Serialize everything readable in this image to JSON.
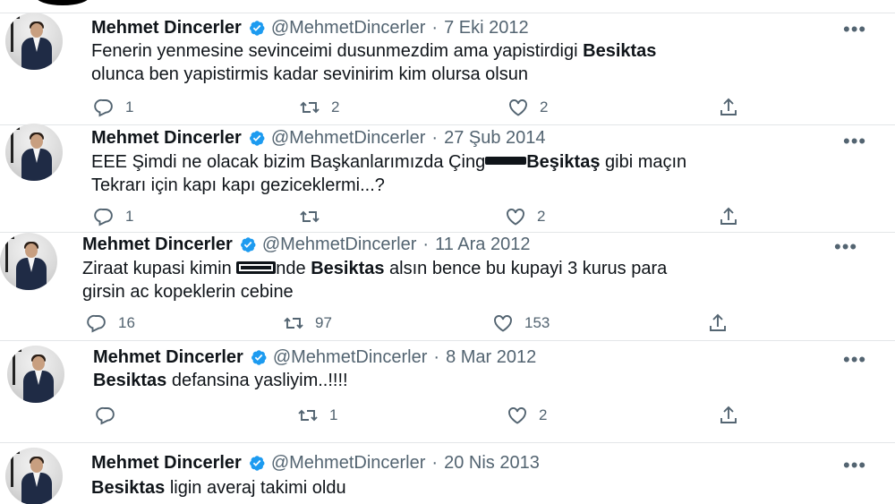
{
  "user": {
    "name": "Mehmet Dincerler",
    "handle": "@MehmetDincerler"
  },
  "tweets": [
    {
      "date": "7 Eki 2012",
      "text_pre": "Fenerin yenmesine sevinceimi dusunmezdim ama yapistirdigi ",
      "text_bold": "Besiktas",
      "text_post": "olunca ben yapistirmis kadar sevinirim kim olursa olsun",
      "replies": "1",
      "retweets": "2",
      "likes": "2"
    },
    {
      "date": "27 Şub 2014",
      "text_pre": "EEE Şimdi ne olacak bizim Başkanlarımızda Çing",
      "text_bold": "Beşiktaş",
      "text_post": " gibi maçın",
      "text_line2": "Tekrarı için kapı kapı geziceklermi...?",
      "replies": "1",
      "retweets": "",
      "likes": "2"
    },
    {
      "date": "11 Ara 2012",
      "text_pre": "Ziraat kupasi kimin ",
      "text_mid": "nde ",
      "text_bold": "Besiktas",
      "text_post": " alsın bence bu kupayi 3 kurus para",
      "text_line2": "girsin ac kopeklerin cebine",
      "replies": "16",
      "retweets": "97",
      "likes": "153"
    },
    {
      "date": "8 Mar 2012",
      "text_bold": "Besiktas",
      "text_post": " defansina yasliyim..!!!!",
      "replies": "",
      "retweets": "1",
      "likes": "2"
    },
    {
      "date": "20 Nis 2013",
      "text_bold": "Besiktas",
      "text_post": " ligin averaj takimi oldu"
    }
  ],
  "colors": {
    "verified": "#1d9bf0",
    "secondary_text": "#536471",
    "divider": "#e3e6e8"
  }
}
